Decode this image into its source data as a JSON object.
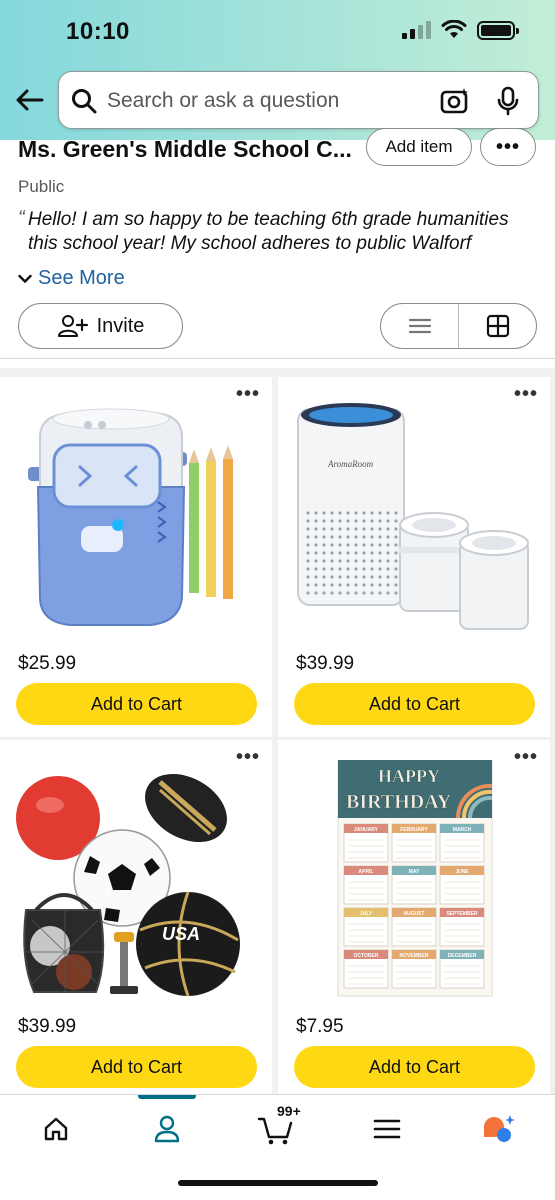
{
  "status_bar": {
    "time": "10:10"
  },
  "search": {
    "placeholder": "Search or ask a question"
  },
  "list": {
    "title": "Ms. Green's Middle School C...",
    "visibility": "Public",
    "description": "Hello! I am so happy to be teaching 6th grade humanities this school year! My school adheres to public Walforf",
    "see_more_label": "See More",
    "add_item_label": "Add item",
    "more_label": "•••",
    "invite_label": "Invite"
  },
  "products": [
    {
      "price": "$25.99",
      "cart_label": "Add to Cart",
      "image_icon": "electric-pencil-sharpener"
    },
    {
      "price": "$39.99",
      "cart_label": "Add to Cart",
      "image_icon": "air-purifier"
    },
    {
      "price": "$39.99",
      "cart_label": "Add to Cart",
      "image_icon": "sports-balls-set"
    },
    {
      "price": "$7.95",
      "cart_label": "Add to Cart",
      "image_icon": "birthday-poster",
      "poster": {
        "heading1": "HAPPY",
        "heading2": "BIRTHDAY",
        "months": [
          "JANUARY",
          "FEBRUARY",
          "MARCH",
          "APRIL",
          "MAY",
          "JUNE",
          "JULY",
          "AUGUST",
          "SEPTEMBER",
          "OCTOBER",
          "NOVEMBER",
          "DECEMBER"
        ]
      }
    }
  ],
  "bottom_nav": {
    "cart_count": "99+"
  },
  "colors": {
    "accent": "#007185",
    "cart_button": "#ffd814",
    "link": "#2162a1"
  }
}
